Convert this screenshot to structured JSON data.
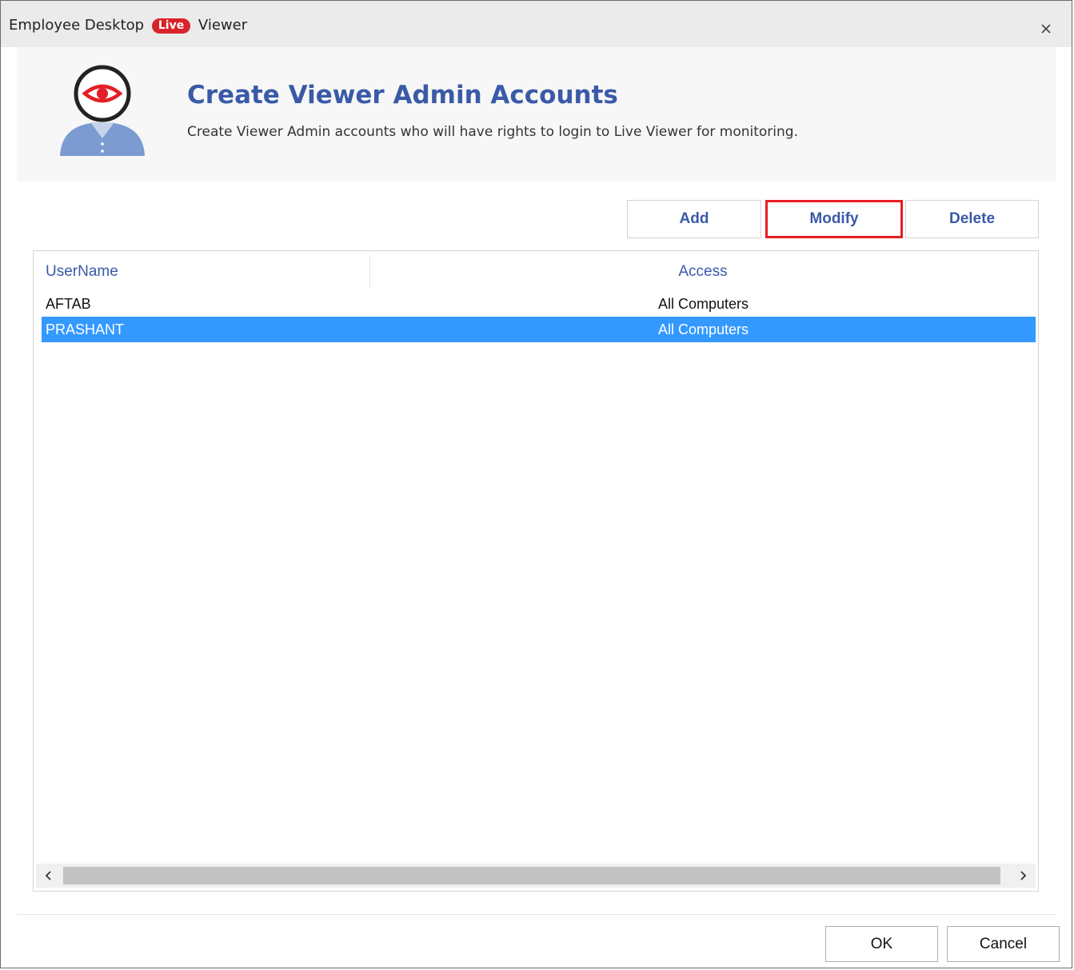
{
  "window": {
    "title_prefix": "Employee Desktop",
    "title_badge": "Live",
    "title_suffix": "Viewer",
    "close_glyph": "×"
  },
  "header": {
    "title": "Create Viewer Admin Accounts",
    "description": "Create Viewer Admin accounts who will have rights to login to Live Viewer for monitoring.",
    "icon": "viewer-admin-avatar-icon"
  },
  "toolbar": {
    "add_label": "Add",
    "modify_label": "Modify",
    "delete_label": "Delete",
    "highlighted": "Modify"
  },
  "table": {
    "columns": [
      "UserName",
      "Access"
    ],
    "rows": [
      {
        "username": "AFTAB",
        "access": "All Computers",
        "selected": false
      },
      {
        "username": "PRASHANT",
        "access": "All Computers",
        "selected": true
      }
    ]
  },
  "scrollbar": {
    "left_glyph": "‹",
    "right_glyph": "›"
  },
  "footer": {
    "ok_label": "OK",
    "cancel_label": "Cancel"
  },
  "colors": {
    "accent": "#3a5aa8",
    "badge": "#d9232a",
    "selection": "#3399ff",
    "highlight_border": "#e81c24"
  }
}
